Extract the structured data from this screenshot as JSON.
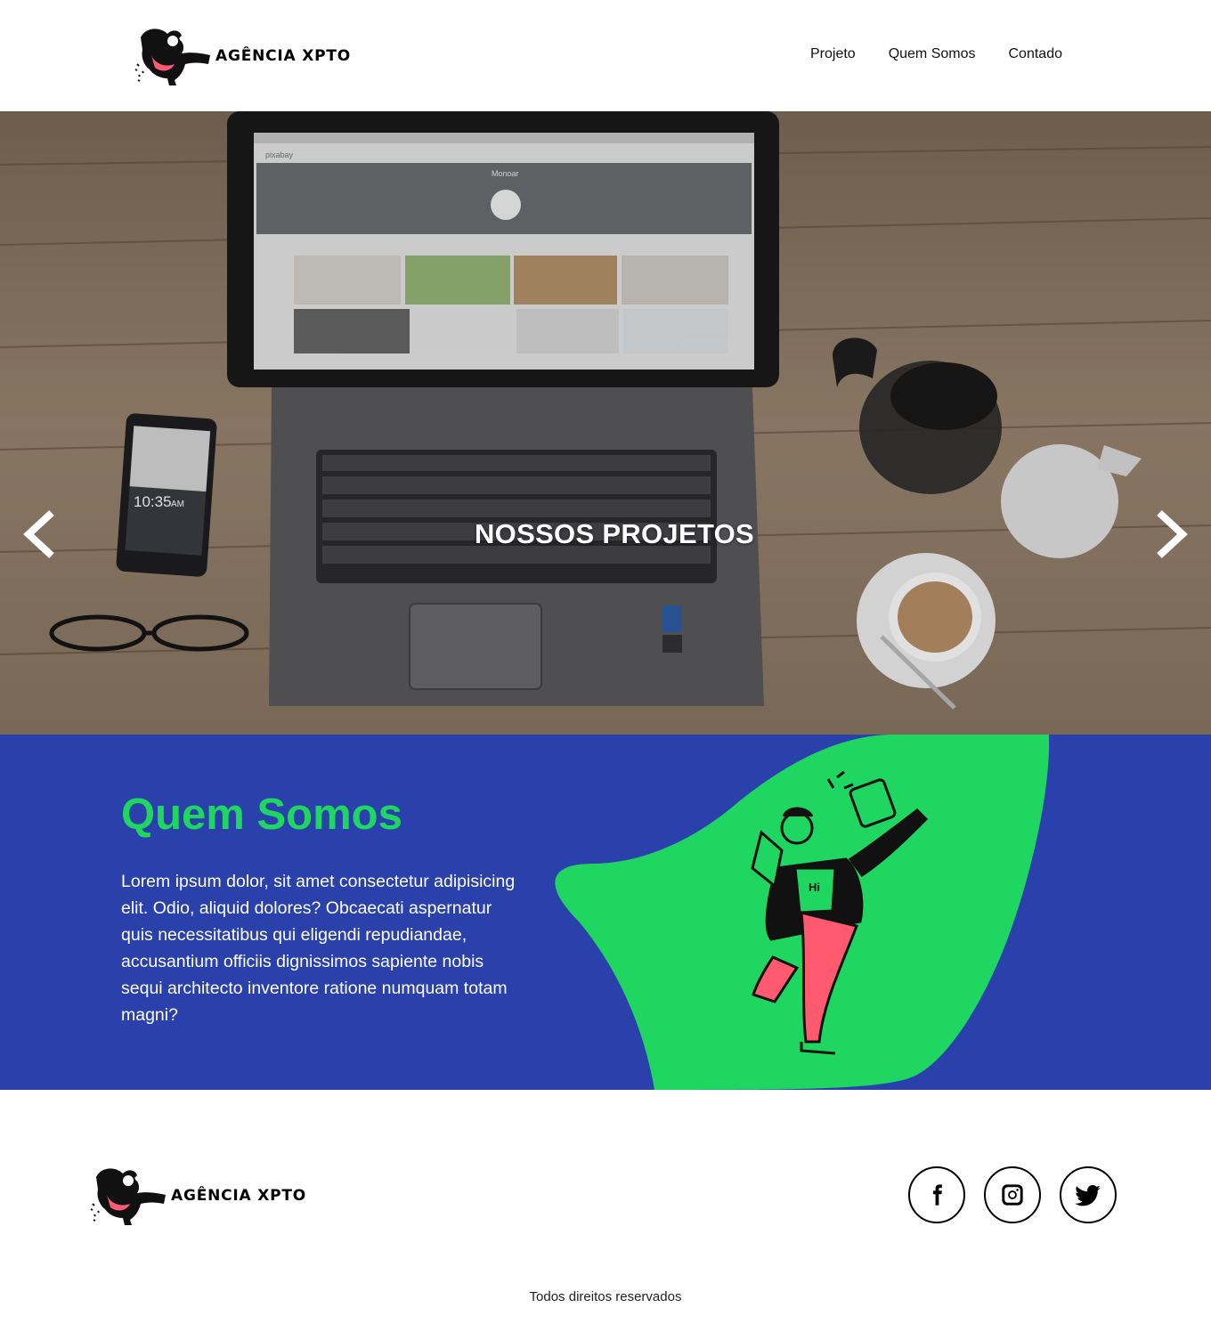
{
  "header": {
    "brand": "AGÊNCIA XPTO",
    "nav": [
      "Projeto",
      "Quem Somos",
      "Contado"
    ]
  },
  "hero": {
    "title": "NOSSOS PROJETOS",
    "screen_site_logo": "pixabay",
    "screen_profile_name": "Monoar",
    "phone_time": "10:35",
    "phone_ampm": "AM"
  },
  "about": {
    "title": "Quem Somos",
    "text": "Lorem ipsum dolor, sit amet consectetur adipisicing elit. Odio, aliquid dolores? Obcaecati aspernatur quis necessitatibus qui eligendi repudiandae, accusantium officiis dignissimos sapiente nobis sequi architecto inventore ratione numquam totam magni?",
    "shirt_text": "Hi"
  },
  "footer": {
    "brand": "AGÊNCIA XPTO",
    "social": [
      "facebook-icon",
      "instagram-icon",
      "twitter-icon"
    ],
    "copyright": "Todos direitos reservados"
  },
  "colors": {
    "about_bg": "#2a41ac",
    "accent_green": "#1fd660"
  }
}
